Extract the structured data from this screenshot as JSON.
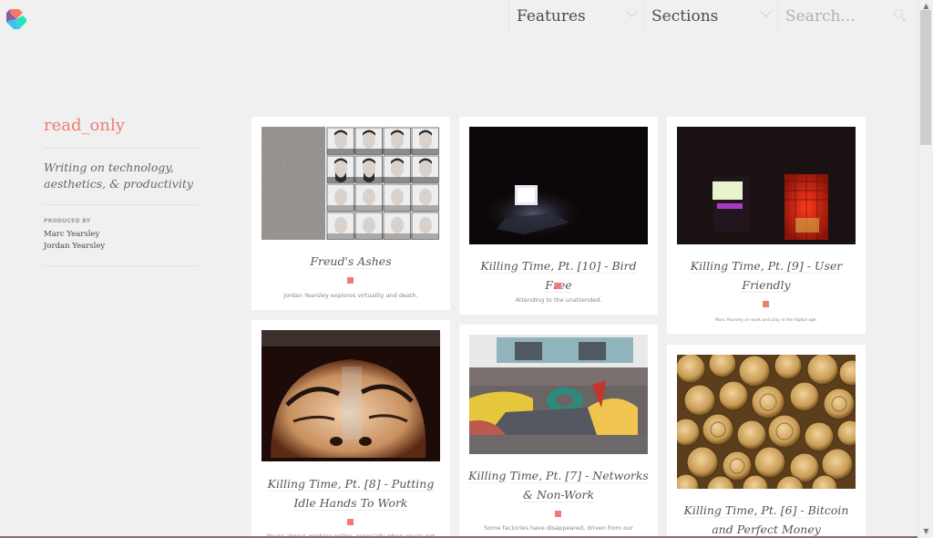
{
  "brand": {
    "logo": "logo-mark-icon",
    "colors": {
      "accent": "#f07b72",
      "purple": "#8e5a9c",
      "coral": "#f57a6a",
      "blue": "#3fc2f0",
      "teal": "#1ee6bd"
    }
  },
  "nav": {
    "features_label": "Features",
    "sections_label": "Sections",
    "search_placeholder": "Search...",
    "search_value": ""
  },
  "sidebar": {
    "title": "read_only",
    "tagline": "Writing on technology, aesthetics, & productivity",
    "produced_by_label": "PRODUCED BY",
    "producers": [
      "Marc Yearsley",
      "Jordan Yearsley"
    ]
  },
  "cards": [
    {
      "title": "Freud's Ashes",
      "excerpt": "Jordan Yearsley explores virtuality and death."
    },
    {
      "title": "Killing Time, Pt. [10] - Bird Free",
      "excerpt": "Attending to the unattended."
    },
    {
      "title": "Killing Time, Pt. [9] - User Friendly",
      "excerpt": "Marc Yearsley on work and play in the digital age."
    },
    {
      "title": "Killing Time, Pt. [8] - Putting Idle Hands To Work",
      "excerpt": "You're always working online, especially when you're not"
    },
    {
      "title": "Killing Time, Pt. [7] - Networks & Non-Work",
      "excerpt": "Some factories have disappeared, driven from our"
    },
    {
      "title": "Killing Time, Pt. [6] - Bitcoin and Perfect Money",
      "excerpt": ""
    }
  ],
  "scrollbar": {
    "up": "▲",
    "down": "▼"
  }
}
